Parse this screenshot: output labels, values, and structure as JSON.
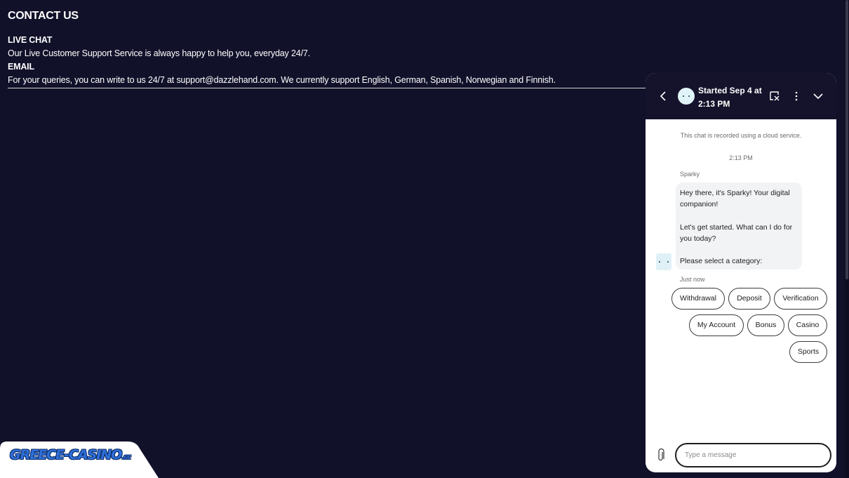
{
  "page": {
    "title": "CONTACT US",
    "sections": [
      {
        "heading": "LIVE CHAT",
        "text": "Our Live Customer Support Service is always happy to help you, everyday 24/7."
      },
      {
        "heading": "EMAIL",
        "text": "For your queries, you can write to us 24/7 at support@dazzlehand.com. We currently support English, German, Spanish, Norwegian and Finnish."
      }
    ]
  },
  "logo": {
    "text": "GREECE-CASINO",
    "suffix": ".cc"
  },
  "chat": {
    "header_title": "Started Sep 4 at 2:13 PM",
    "recorded_note": "This chat is recorded using a cloud service.",
    "time": "2:13 PM",
    "sender": "Sparky",
    "messages": [
      "Hey there, it's Sparky! Your digital companion!",
      "Let's get started. What can I do for you today?",
      "Please select a category:"
    ],
    "status": "Just now",
    "categories": [
      "Withdrawal",
      "Deposit",
      "Verification",
      "My Account",
      "Bonus",
      "Casino",
      "Sports"
    ],
    "input_placeholder": "Type a message"
  },
  "colors": {
    "page_background": "#12112a",
    "chat_header": "#14132b",
    "logo_blue": "#2f6fd8"
  },
  "icons": [
    "back-arrow-icon",
    "bot-avatar-icon",
    "popout-icon",
    "more-options-icon",
    "chevron-down-icon",
    "paperclip-icon"
  ]
}
